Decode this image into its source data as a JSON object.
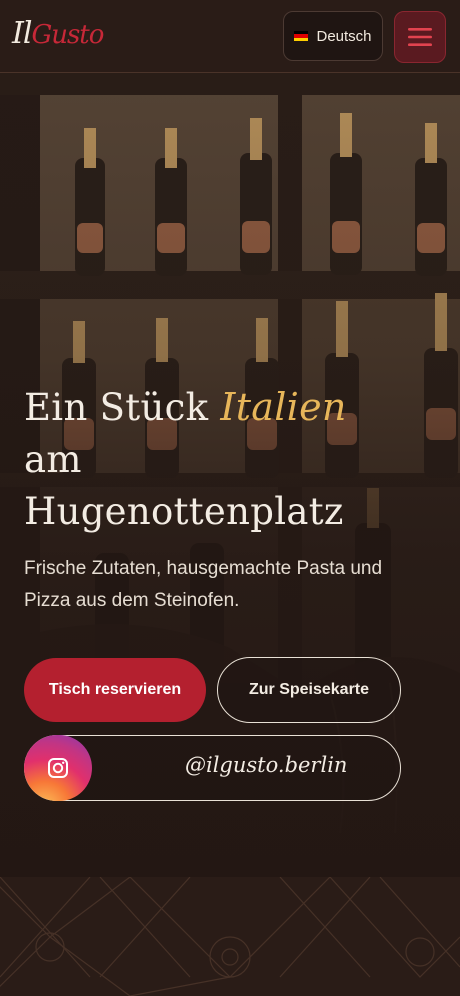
{
  "brand": {
    "logo_il": "Il",
    "logo_gusto": "Gusto"
  },
  "header": {
    "language": {
      "label": "Deutsch",
      "flag_colors": [
        "#000000",
        "#dd0000",
        "#ffce00"
      ]
    },
    "menu_icon": "hamburger-icon"
  },
  "hero": {
    "title_part1": "Ein Stück",
    "title_accent": "Italien",
    "title_part2": "am",
    "title_part3": "Hugenottenplatz",
    "subtitle": "Frische Zutaten, hausgemachte Pasta und Pizza aus dem Steinofen.",
    "buttons": {
      "reserve": "Tisch reservieren",
      "menu": "Zur Speisekarte",
      "instagram": "@ilgusto.berlin"
    }
  },
  "colors": {
    "background": "#231713",
    "accent_red": "#b4202f",
    "accent_gold": "#e7b65a"
  }
}
